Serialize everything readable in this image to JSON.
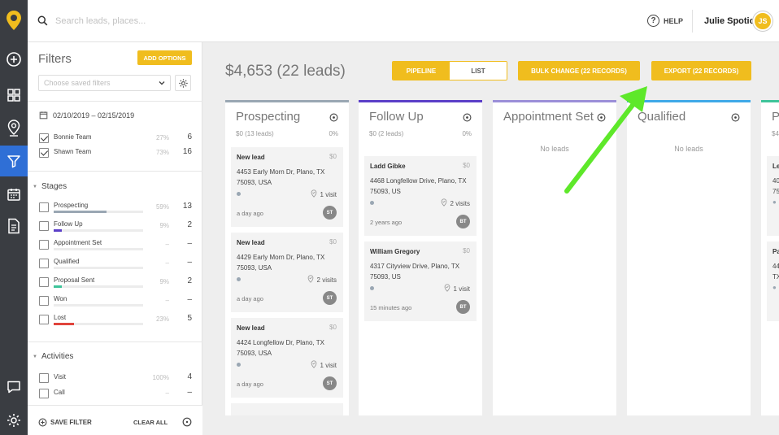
{
  "search": {
    "placeholder": "Search leads, places..."
  },
  "header": {
    "help_label": "HELP",
    "help_icon_glyph": "?",
    "user_name": "Julie Spotio",
    "user_initials": "JS"
  },
  "filters": {
    "title": "Filters",
    "add_options_label": "ADD OPTIONS",
    "saved_filters_placeholder": "Choose saved filters",
    "date_range": "02/10/2019 – 02/15/2019",
    "teams": [
      {
        "label": "Bonnie Team",
        "pct": "27%",
        "count": "6",
        "checked": true
      },
      {
        "label": "Shawn Team",
        "pct": "73%",
        "count": "16",
        "checked": true
      }
    ],
    "stages_title": "Stages",
    "stages": [
      {
        "label": "Prospecting",
        "pct": "59%",
        "count": "13",
        "fill": 0.59,
        "color": "#9aa7b3"
      },
      {
        "label": "Follow Up",
        "pct": "9%",
        "count": "2",
        "fill": 0.09,
        "color": "#5b3fc8"
      },
      {
        "label": "Appointment Set",
        "pct": "–",
        "count": "–",
        "fill": 0,
        "color": "#9aa7b3"
      },
      {
        "label": "Qualified",
        "pct": "–",
        "count": "–",
        "fill": 0,
        "color": "#9aa7b3"
      },
      {
        "label": "Proposal Sent",
        "pct": "9%",
        "count": "2",
        "fill": 0.09,
        "color": "#3fc49a"
      },
      {
        "label": "Won",
        "pct": "–",
        "count": "–",
        "fill": 0,
        "color": "#9aa7b3"
      },
      {
        "label": "Lost",
        "pct": "23%",
        "count": "5",
        "fill": 0.23,
        "color": "#e0443c"
      }
    ],
    "activities_title": "Activities",
    "activities": [
      {
        "label": "Visit",
        "pct": "100%",
        "count": "4"
      },
      {
        "label": "Call",
        "pct": "–",
        "count": "–"
      }
    ],
    "save_filter_label": "SAVE FILTER",
    "clear_all_label": "CLEAR ALL"
  },
  "main": {
    "total": "$4,653 (22 leads)",
    "view_toggle": {
      "pipeline": "PIPELINE",
      "list": "LIST",
      "active": "pipeline"
    },
    "bulk_change_label": "BULK CHANGE (22 RECORDS)",
    "export_label": "EXPORT (22 RECORDS)"
  },
  "columns": [
    {
      "name": "Prospecting",
      "summary": "$0 (13 leads)",
      "pct": "0%",
      "color": "#9aa7b3",
      "cards": [
        {
          "title": "New lead",
          "value": "$0",
          "address": "4453 Early Morn Dr, Plano, TX 75093, USA",
          "visits": "1 visit",
          "ago": "a day ago",
          "initials": "ST"
        },
        {
          "title": "New lead",
          "value": "$0",
          "address": "4429 Early Morn Dr, Plano, TX 75093, USA",
          "visits": "2 visits",
          "ago": "a day ago",
          "initials": "ST"
        },
        {
          "title": "New lead",
          "value": "$0",
          "address": "4424 Longfellow Dr, Plano, TX 75093, USA",
          "visits": "1 visit",
          "ago": "a day ago",
          "initials": "ST"
        }
      ]
    },
    {
      "name": "Follow Up",
      "summary": "$0 (2 leads)",
      "pct": "0%",
      "color": "#5b3fc8",
      "cards": [
        {
          "title": "Ladd Gibke",
          "value": "$0",
          "address": "4468 Longfellow Drive, Plano, TX 75093, US",
          "visits": "2 visits",
          "ago": "2 years ago",
          "initials": "BT"
        },
        {
          "title": "William Gregory",
          "value": "$0",
          "address": "4317 Cityview Drive, Plano, TX 75093, US",
          "visits": "1 visit",
          "ago": "15 minutes ago",
          "initials": "BT"
        }
      ]
    },
    {
      "name": "Appointment Set",
      "empty_text": "No leads",
      "color": "#9b8fd8"
    },
    {
      "name": "Qualified",
      "empty_text": "No leads",
      "color": "#3fa9e8"
    },
    {
      "name": "P",
      "summary": "$4",
      "color": "#3fc49a",
      "card_fragments": [
        {
          "title": "Le",
          "lines": [
            "40",
            "75",
            "●"
          ]
        },
        {
          "title": "Pa",
          "lines": [
            "44",
            "TX",
            "●"
          ]
        }
      ]
    }
  ],
  "icons": {
    "rail": [
      "spotio-logo-icon",
      "add-circle-icon",
      "dashboard-grid-icon",
      "map-pin-icon",
      "filter-funnel-icon",
      "calendar-icon",
      "document-icon",
      "chat-icon",
      "settings-gear-icon"
    ],
    "search": "search-icon",
    "help": "help-circle-icon"
  },
  "colors": {
    "accent": "#f0bd1e",
    "rail": "#3a3d42",
    "rail_active": "#2f6fd6",
    "annotation_arrow": "#5ee82a"
  }
}
